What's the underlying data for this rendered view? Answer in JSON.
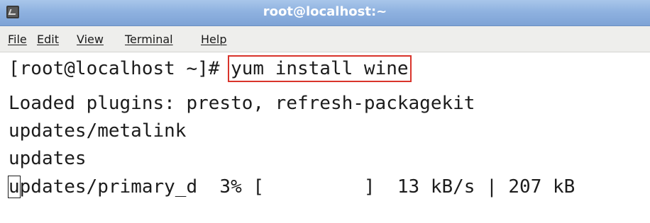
{
  "window": {
    "title": "root@localhost:~"
  },
  "menu": {
    "items": [
      "File",
      "Edit",
      "View",
      "Terminal",
      "Help"
    ]
  },
  "terminal": {
    "prompt": "[root@localhost ~]# ",
    "command": "yum install wine",
    "output": [
      "Loaded plugins: presto, refresh-packagekit",
      "updates/metalink",
      "updates"
    ],
    "progress_line": {
      "cursor_char": "u",
      "rest": "pdates/primary_d  3% [         ]  13 kB/s | 207 kB"
    }
  },
  "colors": {
    "titlebar": "#8fb2e0",
    "highlight_box": "#d9342b"
  }
}
